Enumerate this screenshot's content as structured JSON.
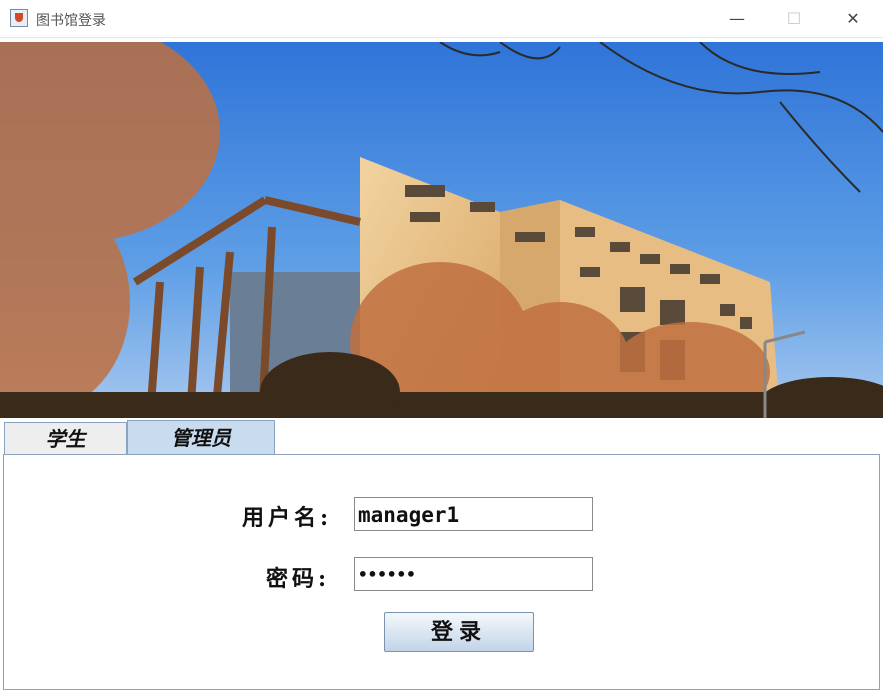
{
  "window": {
    "title": "图书馆登录",
    "minimize_glyph": "—",
    "maximize_glyph": "☐",
    "close_glyph": "✕",
    "app_icon": "java-cup-icon"
  },
  "banner": {
    "description_icon": "library-building-photo"
  },
  "tabs": [
    {
      "label": "学生",
      "selected": false
    },
    {
      "label": "管理员",
      "selected": true
    }
  ],
  "form": {
    "username_label": "用户名:",
    "username_value": "manager1",
    "password_label": "密码:",
    "password_value": "••••••",
    "login_button": "登录"
  },
  "colors": {
    "tab_selected": "#c9dcef",
    "tab_border": "#8aa4c0",
    "sky": "#3a7fd6"
  }
}
